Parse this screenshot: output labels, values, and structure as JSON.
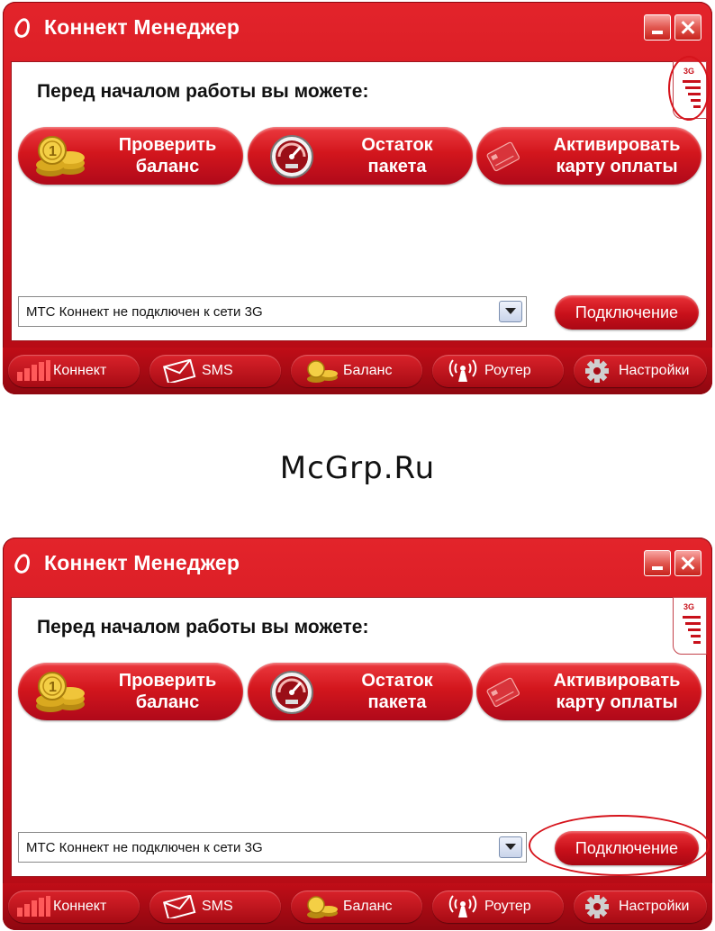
{
  "app": {
    "title": "Коннект Менеджер",
    "heading": "Перед началом работы вы можете:",
    "network_label": "3G",
    "actions": [
      {
        "label_line1": "Проверить",
        "label_line2": "баланс",
        "icon": "coins-icon"
      },
      {
        "label_line1": "Остаток",
        "label_line2": "пакета",
        "icon": "speedometer-icon"
      },
      {
        "label_line1": "Активировать",
        "label_line2": "карту оплаты",
        "icon": "payment-card-icon"
      }
    ],
    "status_text": "МТС Коннект не подключен к сети 3G",
    "connect_label": "Подключение",
    "tabs": [
      {
        "label": "Коннект",
        "icon": "signal-bars-icon"
      },
      {
        "label": "SMS",
        "icon": "envelope-icon"
      },
      {
        "label": "Баланс",
        "icon": "coins-icon"
      },
      {
        "label": "Роутер",
        "icon": "router-icon"
      },
      {
        "label": "Настройки",
        "icon": "gear-icon"
      }
    ],
    "colors": {
      "brand_red": "#c8101a",
      "highlight_ellipse": "#d6141c"
    }
  },
  "watermark": "McGrp.Ru"
}
